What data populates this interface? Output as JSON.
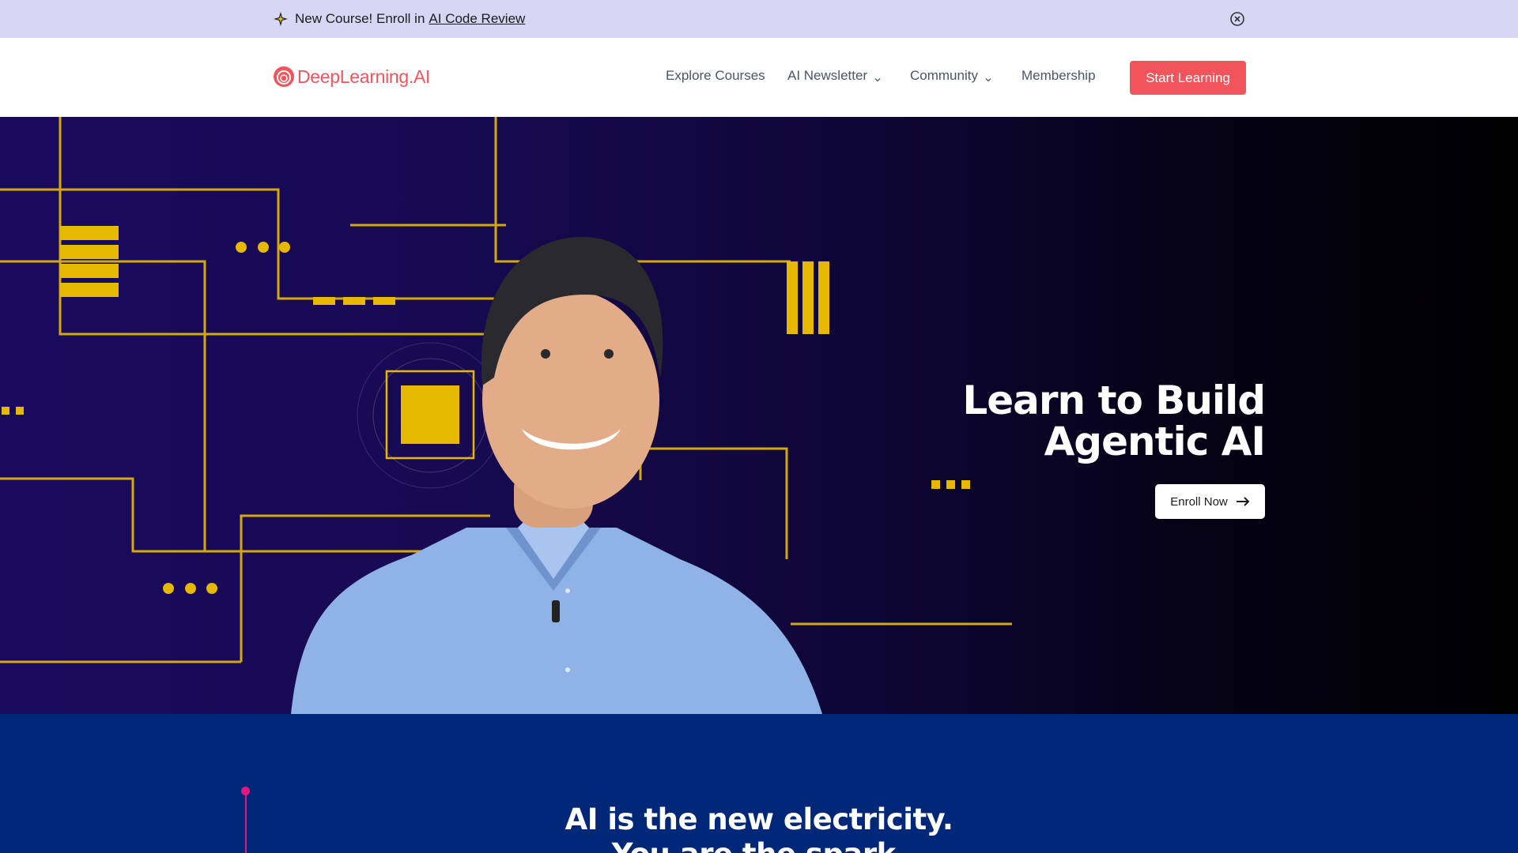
{
  "announcement": {
    "prefix": "New Course! Enroll in",
    "link": "AI Code Review"
  },
  "header": {
    "logo_text": "DeepLearning.AI",
    "nav": {
      "explore": "Explore Courses",
      "newsletter": "AI Newsletter",
      "community": "Community",
      "membership": "Membership"
    },
    "cta": "Start Learning"
  },
  "hero": {
    "title_line1": "Learn to Build",
    "title_line2": "Agentic AI",
    "button": "Enroll Now"
  },
  "mission": {
    "line1": "AI is the new electricity.",
    "line2": "You are the spark."
  },
  "colors": {
    "brand": "#f2545b",
    "announce_bg": "#d6d6f5",
    "circuit": "#e6b800",
    "mission_bg": "#012878",
    "accent_line": "#e5187d"
  },
  "icons": [
    "sparkle-icon",
    "close-circle-icon",
    "logo-icon",
    "chevron-down-icon",
    "arrow-right-icon"
  ]
}
